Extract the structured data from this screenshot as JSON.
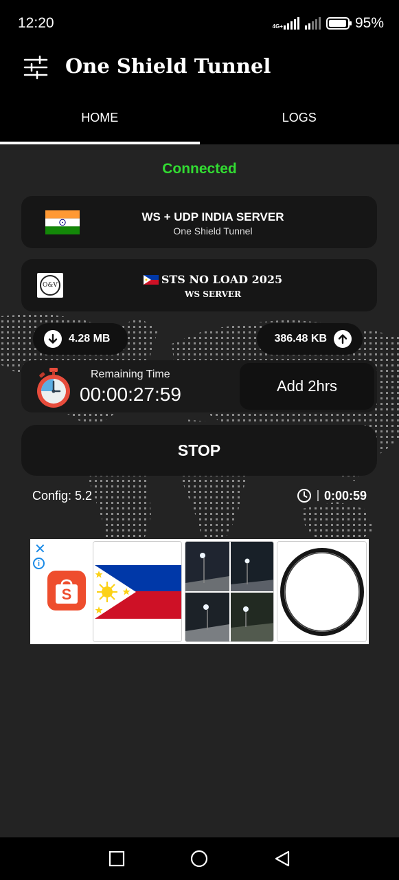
{
  "status_bar": {
    "time": "12:20",
    "network_tag": "4G+",
    "battery": "95%"
  },
  "app": {
    "title": "One Shield Tunnel",
    "menu_icon": "sliders-icon"
  },
  "tabs": [
    {
      "label": "HOME",
      "active": true
    },
    {
      "label": "LOGS",
      "active": false
    }
  ],
  "connection": {
    "status": "Connected",
    "status_color": "#32dc32"
  },
  "server": {
    "name": "WS + UDP INDIA SERVER",
    "subtitle": "One Shield Tunnel",
    "flag_icon": "india-flag-icon"
  },
  "payload": {
    "name": "STS NO LOAD  2025",
    "type": "WS SERVER",
    "logo_text": "O&V",
    "flag_icon": "philippines-flag-icon"
  },
  "traffic": {
    "download": "4.28 MB",
    "upload": "386.48 KB"
  },
  "timer": {
    "label": "Remaining Time",
    "value": "00:00:27:59",
    "add_button": "Add 2hrs"
  },
  "actions": {
    "stop_label": "STOP"
  },
  "footer_info": {
    "config": "Config: 5.2",
    "session_time": "0:00:59"
  },
  "ad": {
    "close_glyph": "✕",
    "info_glyph": "i",
    "advertiser_icon": "shopee-bag-icon",
    "shop_letter": "S",
    "tiles": [
      "philippine-flag",
      "solar-street-lights",
      "rubber-o-ring"
    ]
  },
  "colors": {
    "background": "#232323",
    "bar": "#000000",
    "card": "#161616",
    "accent_green": "#32dc32",
    "ad_blue": "#1a8ae6",
    "shop_orange": "#ee4d2d"
  }
}
